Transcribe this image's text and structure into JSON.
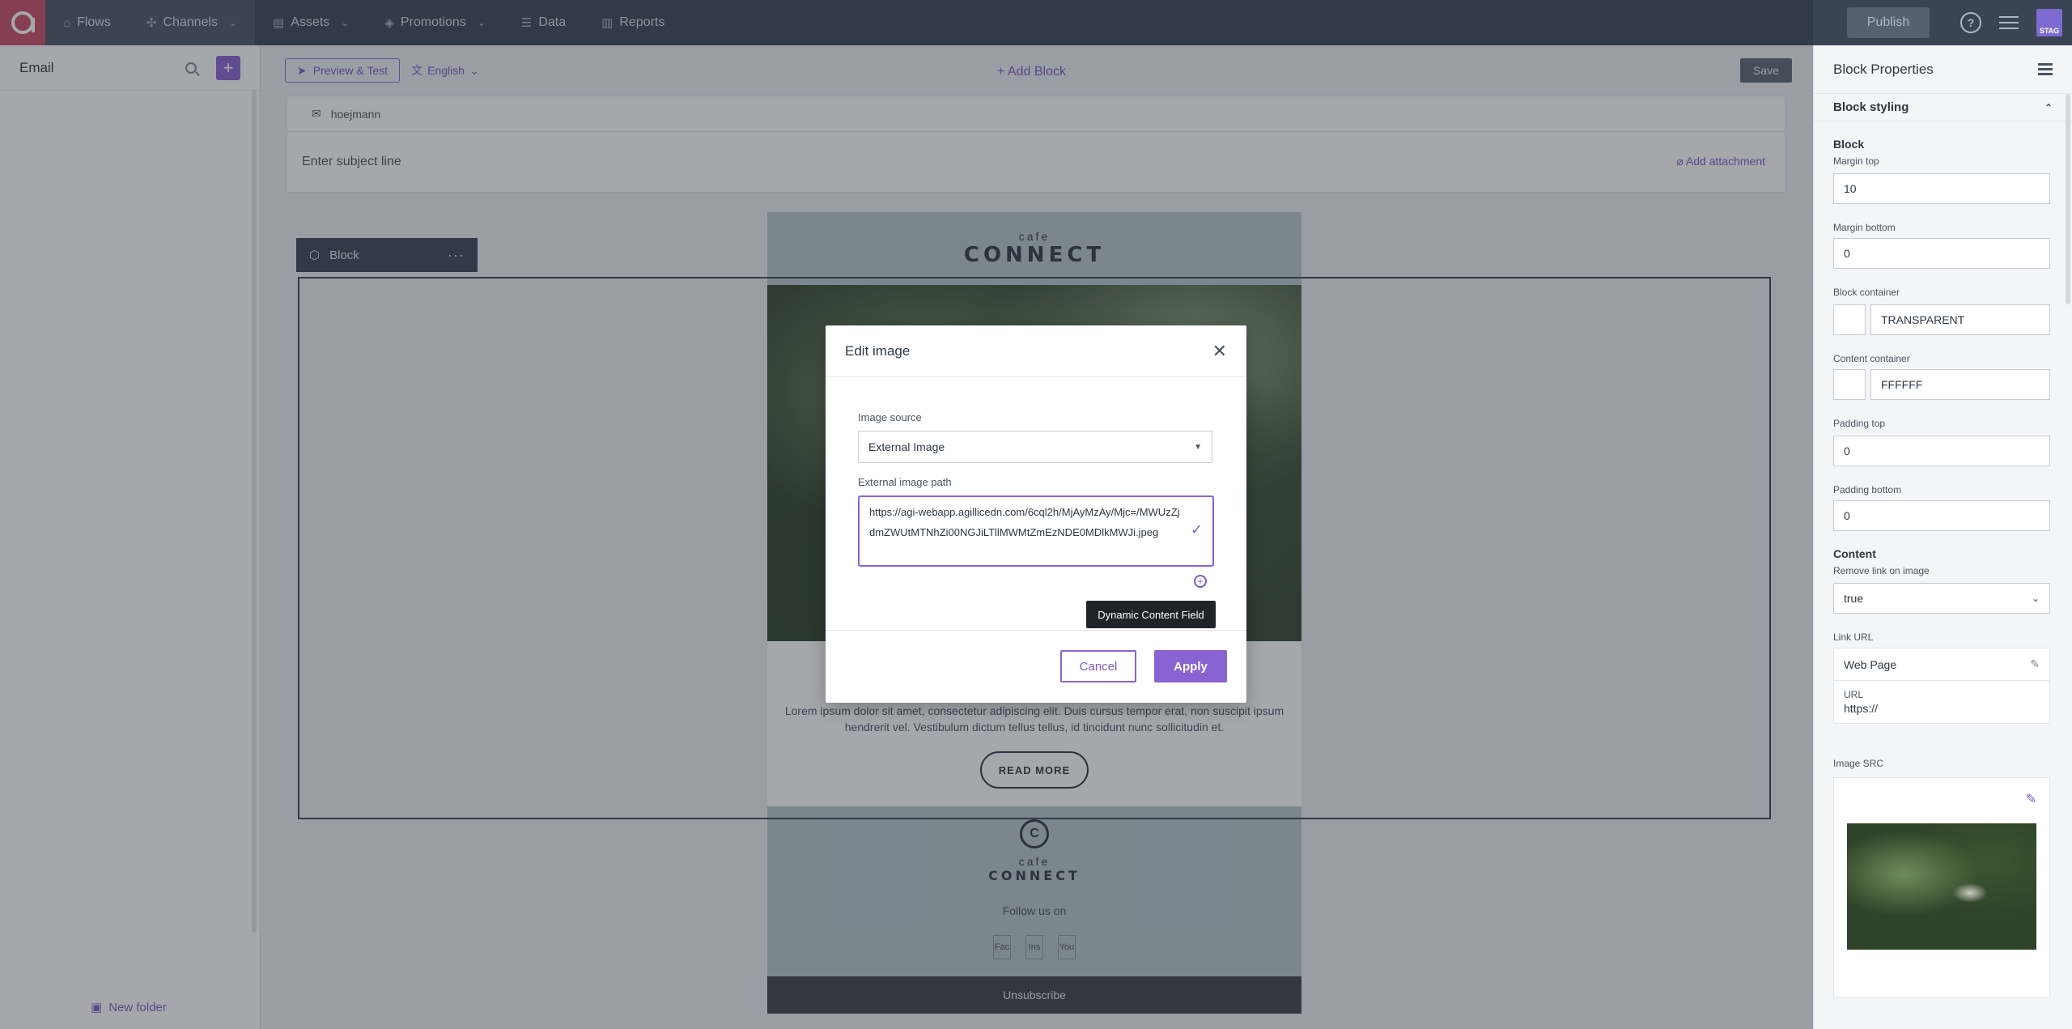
{
  "nav": {
    "items": [
      {
        "label": "Flows",
        "icon": "flows-icon",
        "caret": false,
        "active": true
      },
      {
        "label": "Channels",
        "icon": "channels-icon",
        "caret": true,
        "active": true
      },
      {
        "label": "Assets",
        "icon": "assets-icon",
        "caret": true,
        "active": false
      },
      {
        "label": "Promotions",
        "icon": "promotions-icon",
        "caret": true,
        "active": false
      },
      {
        "label": "Data",
        "icon": "data-icon",
        "caret": false,
        "active": false
      },
      {
        "label": "Reports",
        "icon": "reports-icon",
        "caret": false,
        "active": false
      }
    ],
    "publish_label": "Publish",
    "help_glyph": "?",
    "stage_badge": "STAG"
  },
  "left": {
    "title": "Email",
    "new_folder_label": "New folder"
  },
  "toolbar": {
    "preview_label": "Preview & Test",
    "language_label": "English",
    "add_block_label": "+ Add Block",
    "save_label": "Save"
  },
  "email": {
    "sender": "hoejmann",
    "subject_placeholder": "Enter subject line",
    "add_attachment_label": "Add attachment",
    "header_small": "cafe",
    "header_big": "CONNECT",
    "lorem": "Lorem ipsum dolor sit amet, consectetur adipiscing elit. Duis cursus tempor erat, non suscipit ipsum hendrerit vel. Vestibulum dictum tellus tellus, id tincidunt nunc sollicitudin et.",
    "read_more_label": "READ MORE",
    "footer_logo_glyph": "C",
    "footer_small": "cafe",
    "footer_big": "CONNECT",
    "follow_label": "Follow us on",
    "socials": [
      "Fac",
      "Ins",
      "You"
    ],
    "unsubscribe_label": "Unsubscribe",
    "block_label": "Block",
    "block_menu": "···"
  },
  "modal": {
    "title": "Edit image",
    "image_source_label": "Image source",
    "image_source_value": "External Image",
    "external_path_label": "External image path",
    "external_path_value": "https://agi-webapp.agillicedn.com/6cql2h/MjAyMzAy/Mjc=/MWUzZjdmZWUtMTNhZi00NGJiLTllMWMtZmEzNDE0MDlkMWJi.jpeg",
    "tooltip": "Dynamic Content Field",
    "cancel_label": "Cancel",
    "apply_label": "Apply"
  },
  "right": {
    "title": "Block Properties",
    "section_title": "Block styling",
    "block_subhead": "Block",
    "margin_top_label": "Margin top",
    "margin_top_value": "10",
    "margin_bottom_label": "Margin bottom",
    "margin_bottom_value": "0",
    "block_container_label": "Block container",
    "block_container_value": "TRANSPARENT",
    "content_container_label": "Content container",
    "content_container_value": "FFFFFF",
    "padding_top_label": "Padding top",
    "padding_top_value": "0",
    "padding_bottom_label": "Padding bottom",
    "padding_bottom_value": "0",
    "content_subhead": "Content",
    "remove_link_label": "Remove link on image",
    "remove_link_value": "true",
    "link_url_label": "Link URL",
    "link_url_type": "Web Page",
    "url_label": "URL",
    "url_value": "https://",
    "image_src_label": "Image SRC"
  },
  "colors": {
    "accent": "#8a63d2",
    "topnav": "#3a4453",
    "logo": "#c94b66"
  }
}
